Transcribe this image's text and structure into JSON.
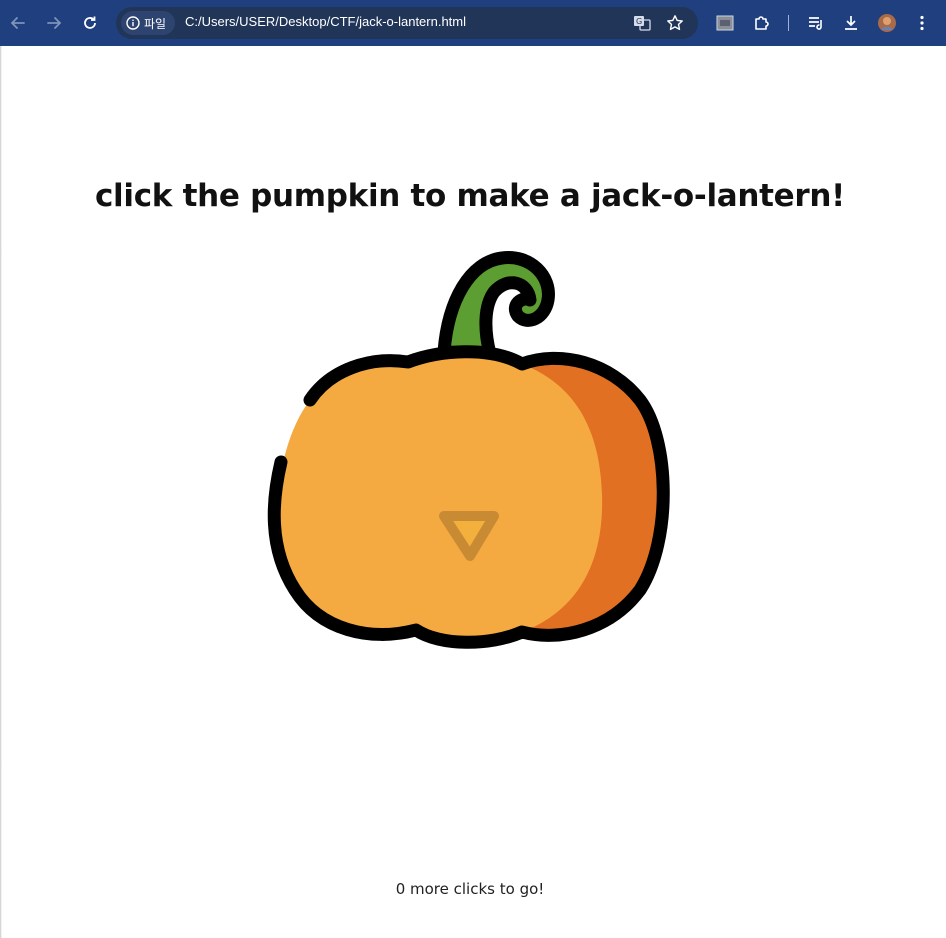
{
  "browser": {
    "chip_label": "파일",
    "url": "C:/Users/USER/Desktop/CTF/jack-o-lantern.html",
    "icons": [
      "back-icon",
      "forward-icon",
      "reload-icon",
      "info-icon",
      "translate-icon",
      "bookmark-star-icon",
      "extension-tile-icon",
      "puzzle-icon",
      "reading-list-icon",
      "download-icon",
      "profile-avatar-icon",
      "more-menu-icon"
    ]
  },
  "page": {
    "heading": "click the pumpkin to make a jack-o-lantern!",
    "counter_text": "0 more clicks to go!"
  },
  "colors": {
    "toolbar": "#1f3f7f",
    "pumpkin_body": "#f4aa41",
    "pumpkin_shade": "#e27022",
    "stem": "#5c9e31",
    "outline": "#000000",
    "face": "#c88b34"
  }
}
